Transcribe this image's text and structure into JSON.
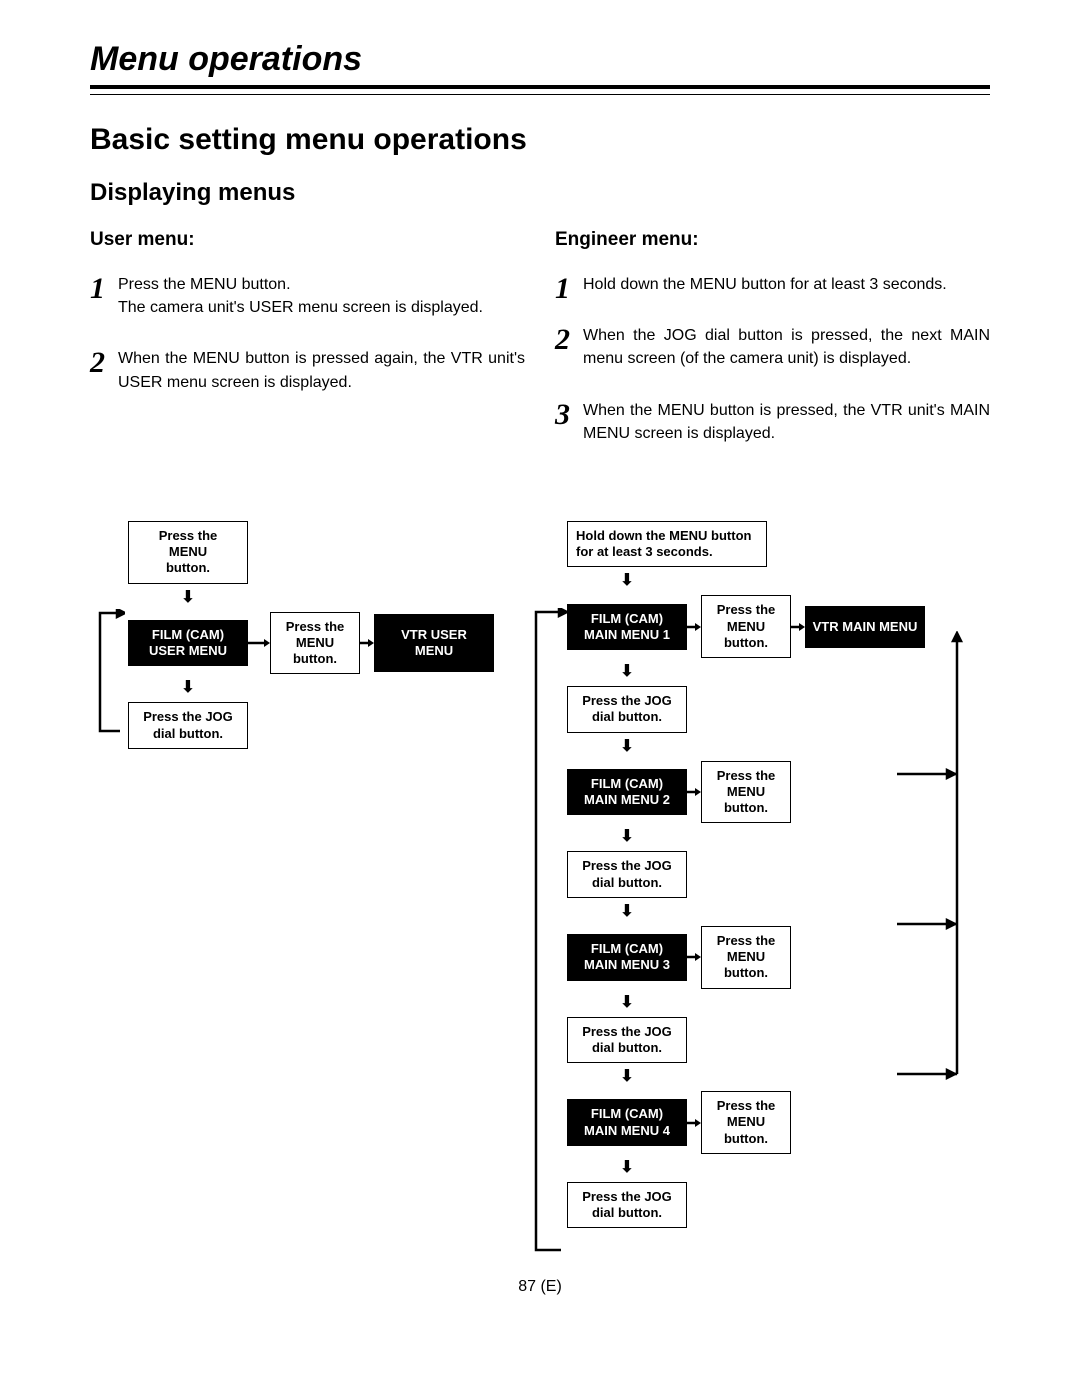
{
  "title": "Menu operations",
  "section": "Basic setting menu operations",
  "subsection": "Displaying menus",
  "user_menu": {
    "title": "User menu:",
    "steps": [
      "Press the MENU button.\nThe camera unit's USER menu screen is displayed.",
      "When the MENU button is pressed again, the VTR unit's USER menu screen is displayed."
    ]
  },
  "engineer_menu": {
    "title": "Engineer menu:",
    "steps": [
      "Hold down the MENU button for at least 3 seconds.",
      "When the JOG dial button is pressed, the next MAIN menu screen (of the camera unit) is displayed.",
      "When the MENU button is pressed, the VTR unit's MAIN MENU screen is displayed."
    ]
  },
  "left_diag": {
    "start": "Press the MENU\nbutton.",
    "menu1": "FILM (CAM)\nUSER MENU",
    "bridge": "Press the\nMENU button.",
    "menu2": "VTR USER MENU",
    "jog": "Press the JOG\ndial button."
  },
  "right_diag": {
    "start": "Hold down the MENU button\nfor at least 3 seconds.",
    "menus": [
      "FILM (CAM)\nMAIN MENU 1",
      "FILM (CAM)\nMAIN MENU 2",
      "FILM (CAM)\nMAIN MENU 3",
      "FILM (CAM)\nMAIN MENU 4"
    ],
    "bridge": "Press the\nMENU button.",
    "jog": "Press the JOG\ndial button.",
    "vtr": "VTR MAIN MENU"
  },
  "arrow_down": "⬇",
  "page_number": "87 (E)"
}
